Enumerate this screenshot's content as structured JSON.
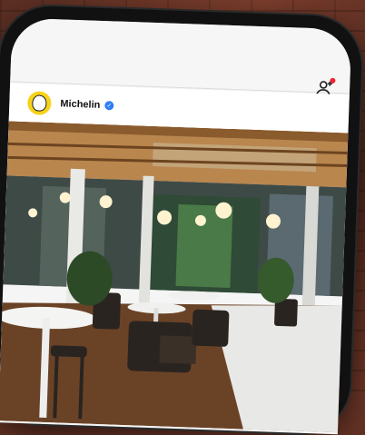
{
  "post": {
    "username": "Michelin",
    "verified": true
  },
  "icons": {
    "add_user": "add-user-icon",
    "avatar": "michelin-man-avatar",
    "verified": "verified-check-icon"
  },
  "colors": {
    "avatar_bg": "#f7d21a",
    "verified": "#2d7ef7",
    "wood_ceiling": "#b9864e",
    "floor": "#6a4327",
    "wall": "#5a2e22"
  }
}
